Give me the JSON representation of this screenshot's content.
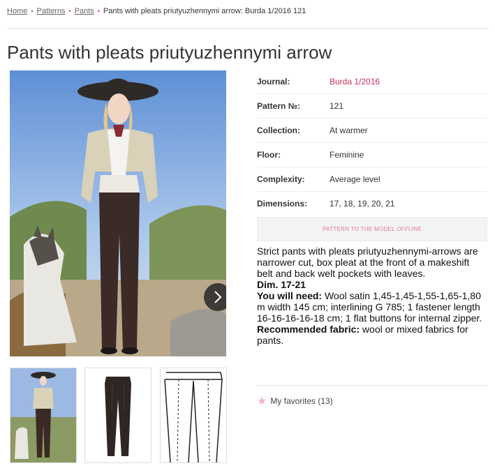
{
  "breadcrumb": {
    "home": "Home",
    "patterns": "Patterns",
    "pants": "Pants",
    "current": "Pants with pleats priutyuzhennymi arrow: Burda 1/2016 121"
  },
  "page_title": "Pants with pleats priutyuzhennymi arrow",
  "details": [
    {
      "label": "Journal:",
      "value": "Burda 1/2016"
    },
    {
      "label": "Pattern №:",
      "value": "121"
    },
    {
      "label": "Collection:",
      "value": "At warmer"
    },
    {
      "label": "Floor:",
      "value": "Feminine"
    },
    {
      "label": "Complexity:",
      "value": "Average level"
    },
    {
      "label": "Dimensions:",
      "value": "17, 18, 19, 20, 21"
    }
  ],
  "offline_button": "PATTERN TO THE MODEL OFFLINE",
  "description": {
    "intro": "Strict pants with pleats priutyuzhennymi-arrows are narrower cut, box pleat at the front of a makeshift belt and back welt pockets with leaves.",
    "dim": "Dim. 17-21",
    "need_label": "You will need:",
    "need_text": " Wool satin 1,45-1,45-1,55-1,65-1,80 m width 145 cm; interlining G 785; 1 fastener length 16-16-16-16-18 cm; 1 flat buttons for internal zipper.",
    "fabric_label": "Recommended fabric:",
    "fabric_text": " wool or mixed fabrics for pants."
  },
  "favorites": "My favorites (13)",
  "colors": {
    "accent": "#c8325a",
    "star": "#f2b5c6"
  },
  "icons": {
    "next": "chevron-right-icon",
    "favorite": "star-icon"
  }
}
